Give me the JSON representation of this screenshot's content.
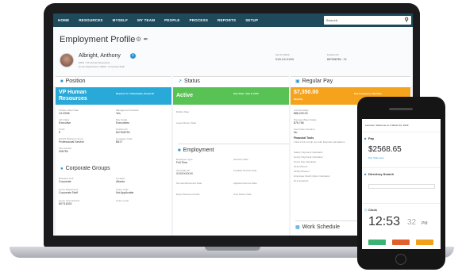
{
  "nav": {
    "items": [
      "HOME",
      "RESOURCES",
      "MYSELF",
      "MY TEAM",
      "PEOPLE",
      "PROCESS",
      "REPORTS",
      "SETUP"
    ],
    "search_placeholder": "Search"
  },
  "profile": {
    "title": "Employment Profile",
    "name": "Albright, Anthony",
    "subtitle1": "HRIS / VP Human Resources",
    "subtitle2": "Home Department: 10000 - Corporate Staff",
    "tax_id_label": "Tax ID (SSN)",
    "tax_id_value": "XXX-XX-XXXX",
    "position_id_label": "Position ID",
    "position_id_value": "807006750 - Y1"
  },
  "position": {
    "header": "Position",
    "band_title": "VP Human Resources",
    "band_right": "Reports To: Chaminade, Susan M",
    "fields": [
      {
        "label": "Position Start Date",
        "value": "1/1/2006"
      },
      {
        "label": "Management Position",
        "value": "Yes"
      },
      {
        "label": "Job Class",
        "value": "Executive"
      },
      {
        "label": "Pay Grade",
        "value": "Executives"
      },
      {
        "label": "FLSA",
        "value": "E"
      },
      {
        "label": "Position ID",
        "value": "807006750"
      },
      {
        "label": "NAICS Workers' Comp",
        "value": "Professional Service"
      },
      {
        "label": "Company Code",
        "value": "B51T"
      },
      {
        "label": "File Number",
        "value": "006750"
      }
    ]
  },
  "corporate": {
    "header": "Corporate Groups",
    "fields": [
      {
        "label": "Business Unit",
        "value": "Corporate"
      },
      {
        "label": "Location",
        "value": "Atlanta"
      },
      {
        "label": "Home Department",
        "value": "Corporate Staff"
      },
      {
        "label": "Union Code",
        "value": "Not Applicable"
      },
      {
        "label": "Home Cost Number",
        "value": "807/16032"
      },
      {
        "label": "Union Local",
        "value": ""
      }
    ]
  },
  "status": {
    "header": "Status",
    "band_title": "Active",
    "band_right": "Hire Date: July 8, 2015",
    "fields": [
      {
        "label": "Rehire Date",
        "value": ""
      },
      {
        "label": "Leave Return Date",
        "value": ""
      }
    ]
  },
  "employment": {
    "header": "Employment",
    "fields": [
      {
        "label": "Employee Type",
        "value": "Full Time"
      },
      {
        "label": "Seniority Date",
        "value": ""
      },
      {
        "label": "Associate ID",
        "value": "XXXXXXXXX"
      },
      {
        "label": "Credited Service Date",
        "value": ""
      },
      {
        "label": "Normal Retirement Date",
        "value": ""
      },
      {
        "label": "Adjusted Service Date",
        "value": ""
      },
      {
        "label": "Early Retirement Date",
        "value": ""
      },
      {
        "label": "ACA Return Date",
        "value": ""
      }
    ]
  },
  "pay": {
    "header": "Regular Pay",
    "band_title": "$7,350.00",
    "band_sub": "Monthly",
    "band_right": "Pay Frequency: Monthly",
    "fields": [
      {
        "label": "Annual Salary",
        "value": "$88,200.00"
      },
      {
        "label": "Previous Base Salary",
        "value": "$76,766"
      },
      {
        "label": "Use Pulse Overtime",
        "value": "No"
      }
    ],
    "tools_header": "Financial Tools",
    "tools": [
      "Click a link to help you with financial calculations.",
      "Salary Paycheck Calculator",
      "Hourly Paycheck Calculator",
      "Gross Pay Calculator",
      "401k Planner",
      "403(b) Planner",
      "Employee Stock Option Calculator",
      "W-4 Assistant"
    ]
  },
  "work_schedule": {
    "header": "Work Schedule"
  },
  "phone": {
    "top_text": "Last Hire: Welcome on 2 March 10, 2019",
    "pay_label": "Pay",
    "pay_amount": "$2568.65",
    "pay_note": "Pay Statement",
    "benefits_label": "Directory Search",
    "clock_label": "Clock",
    "time": "12:53",
    "seconds": "32",
    "ampm": "PM",
    "btn_colors": [
      "#3cb371",
      "#e35f2b",
      "#f0a01a"
    ]
  },
  "colors": {
    "nav": "#1f4a5c",
    "position_band": "#29a9d8",
    "status_band": "#58c254",
    "pay_band": "#f5a21c"
  }
}
